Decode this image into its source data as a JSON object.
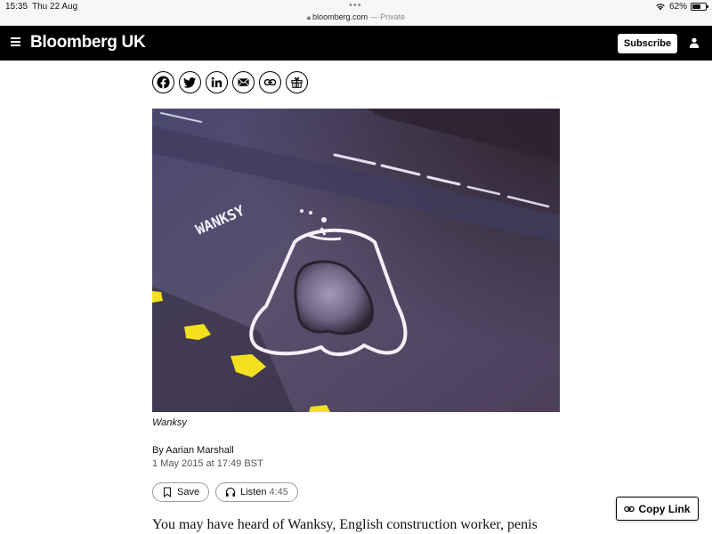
{
  "status_bar": {
    "time": "15:35",
    "date": "Thu 22 Aug",
    "url": "bloomberg.com",
    "url_suffix": "— Private",
    "battery": "62%",
    "battery_level": 0.62
  },
  "header": {
    "brand": "Bloomberg UK",
    "subscribe_label": "Subscribe",
    "background": "#000000"
  },
  "share": {
    "buttons": [
      {
        "icon": "facebook-icon"
      },
      {
        "icon": "twitter-icon"
      },
      {
        "icon": "linkedin-icon"
      },
      {
        "icon": "email-icon"
      },
      {
        "icon": "link-icon"
      },
      {
        "icon": "gift-icon"
      }
    ]
  },
  "photo": {
    "graffiti_text": "WANKSY",
    "caption": "Wanksy"
  },
  "article": {
    "byline_prefix": "By",
    "author": "Aarian Marshall",
    "timestamp": "1 May 2015 at 17:49 BST",
    "save_label": "Save",
    "listen_label": "Listen",
    "listen_duration": "4:45",
    "body_first_line": "You may have heard of Wanksy, English construction worker, penis"
  },
  "copy_link": {
    "label": "Copy Link"
  }
}
